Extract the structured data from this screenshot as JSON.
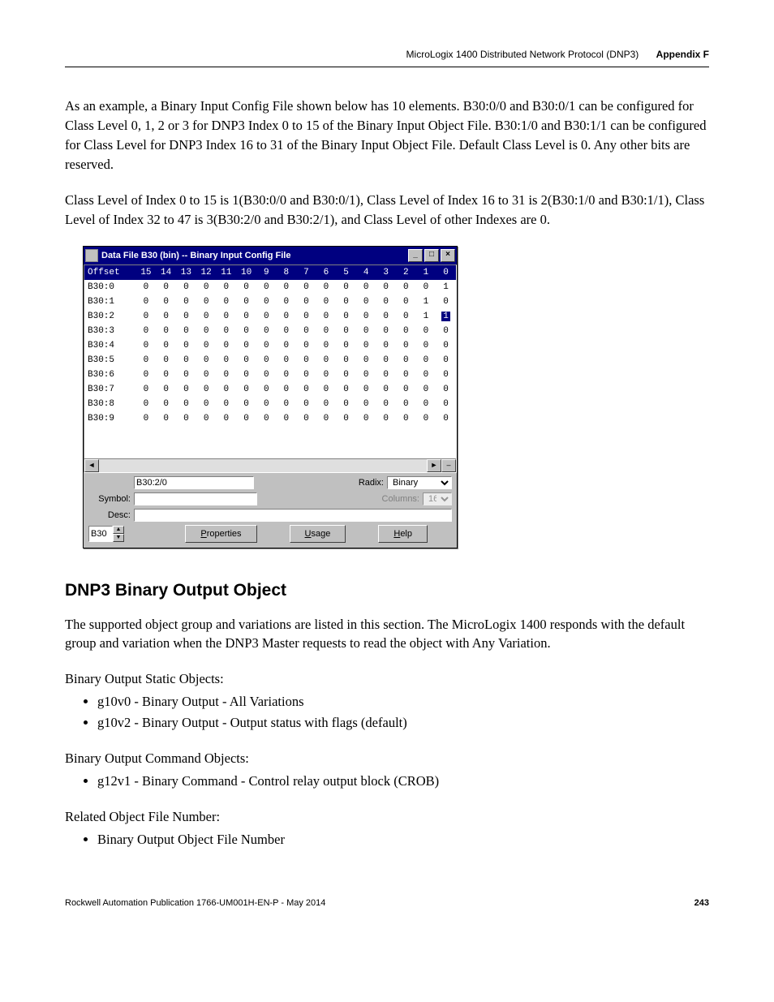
{
  "runningHead": {
    "title": "MicroLogix 1400 Distributed Network Protocol (DNP3)",
    "appendix": "Appendix F"
  },
  "para1": "As an example, a Binary Input Config File shown below has 10 elements. B30:0/0 and B30:0/1 can be configured for Class Level 0, 1, 2 or 3 for DNP3 Index 0 to 15 of the Binary Input Object File. B30:1/0 and B30:1/1 can be configured for Class Level for DNP3 Index 16 to 31 of the Binary Input Object File. Default Class Level is 0. Any other bits are reserved.",
  "para2": "Class Level of Index 0 to 15 is 1(B30:0/0 and B30:0/1), Class Level of Index 16 to 31 is 2(B30:1/0 and B30:1/1), Class Level of Index 32 to 47 is 3(B30:2/0 and B30:2/1), and Class Level of other Indexes are 0.",
  "window": {
    "title": "Data File B30 (bin)  --  Binary Input Config File",
    "offsetHeader": "Offset",
    "bitHeaders": [
      "15",
      "14",
      "13",
      "12",
      "11",
      "10",
      "9",
      "8",
      "7",
      "6",
      "5",
      "4",
      "3",
      "2",
      "1",
      "0"
    ],
    "rows": [
      {
        "label": "B30:0",
        "bits": [
          "0",
          "0",
          "0",
          "0",
          "0",
          "0",
          "0",
          "0",
          "0",
          "0",
          "0",
          "0",
          "0",
          "0",
          "0",
          "1"
        ]
      },
      {
        "label": "B30:1",
        "bits": [
          "0",
          "0",
          "0",
          "0",
          "0",
          "0",
          "0",
          "0",
          "0",
          "0",
          "0",
          "0",
          "0",
          "0",
          "1",
          "0"
        ]
      },
      {
        "label": "B30:2",
        "bits": [
          "0",
          "0",
          "0",
          "0",
          "0",
          "0",
          "0",
          "0",
          "0",
          "0",
          "0",
          "0",
          "0",
          "0",
          "1",
          "1"
        ],
        "selectedCol": 15
      },
      {
        "label": "B30:3",
        "bits": [
          "0",
          "0",
          "0",
          "0",
          "0",
          "0",
          "0",
          "0",
          "0",
          "0",
          "0",
          "0",
          "0",
          "0",
          "0",
          "0"
        ]
      },
      {
        "label": "B30:4",
        "bits": [
          "0",
          "0",
          "0",
          "0",
          "0",
          "0",
          "0",
          "0",
          "0",
          "0",
          "0",
          "0",
          "0",
          "0",
          "0",
          "0"
        ]
      },
      {
        "label": "B30:5",
        "bits": [
          "0",
          "0",
          "0",
          "0",
          "0",
          "0",
          "0",
          "0",
          "0",
          "0",
          "0",
          "0",
          "0",
          "0",
          "0",
          "0"
        ]
      },
      {
        "label": "B30:6",
        "bits": [
          "0",
          "0",
          "0",
          "0",
          "0",
          "0",
          "0",
          "0",
          "0",
          "0",
          "0",
          "0",
          "0",
          "0",
          "0",
          "0"
        ]
      },
      {
        "label": "B30:7",
        "bits": [
          "0",
          "0",
          "0",
          "0",
          "0",
          "0",
          "0",
          "0",
          "0",
          "0",
          "0",
          "0",
          "0",
          "0",
          "0",
          "0"
        ]
      },
      {
        "label": "B30:8",
        "bits": [
          "0",
          "0",
          "0",
          "0",
          "0",
          "0",
          "0",
          "0",
          "0",
          "0",
          "0",
          "0",
          "0",
          "0",
          "0",
          "0"
        ]
      },
      {
        "label": "B30:9",
        "bits": [
          "0",
          "0",
          "0",
          "0",
          "0",
          "0",
          "0",
          "0",
          "0",
          "0",
          "0",
          "0",
          "0",
          "0",
          "0",
          "0"
        ]
      }
    ],
    "addressValue": "B30:2/0",
    "radixLabel": "Radix:",
    "radixValue": "Binary",
    "symbolLabel": "Symbol:",
    "symbolValue": "",
    "columnsLabel": "Columns:",
    "columnsValue": "16",
    "descLabel": "Desc:",
    "descValue": "",
    "fileSpin": "B30",
    "btnProperties": "Properties",
    "btnUsage": "Usage",
    "btnHelp": "Help"
  },
  "h2": "DNP3 Binary Output Object",
  "para3": "The supported object group and variations are listed in this section. The MicroLogix 1400 responds with the default group and variation when the DNP3 Master requests to read the object with Any Variation.",
  "staticHeader": "Binary Output Static Objects:",
  "staticList": [
    "g10v0 - Binary Output - All Variations",
    "g10v2 - Binary Output - Output status with flags (default)"
  ],
  "cmdHeader": "Binary Output Command Objects:",
  "cmdList": [
    "g12v1 - Binary Command - Control relay output block (CROB)"
  ],
  "relHeader": "Related Object File Number:",
  "relList": [
    "Binary Output Object File Number"
  ],
  "footer": {
    "pub": "Rockwell Automation Publication 1766-UM001H-EN-P - May 2014",
    "page": "243"
  }
}
